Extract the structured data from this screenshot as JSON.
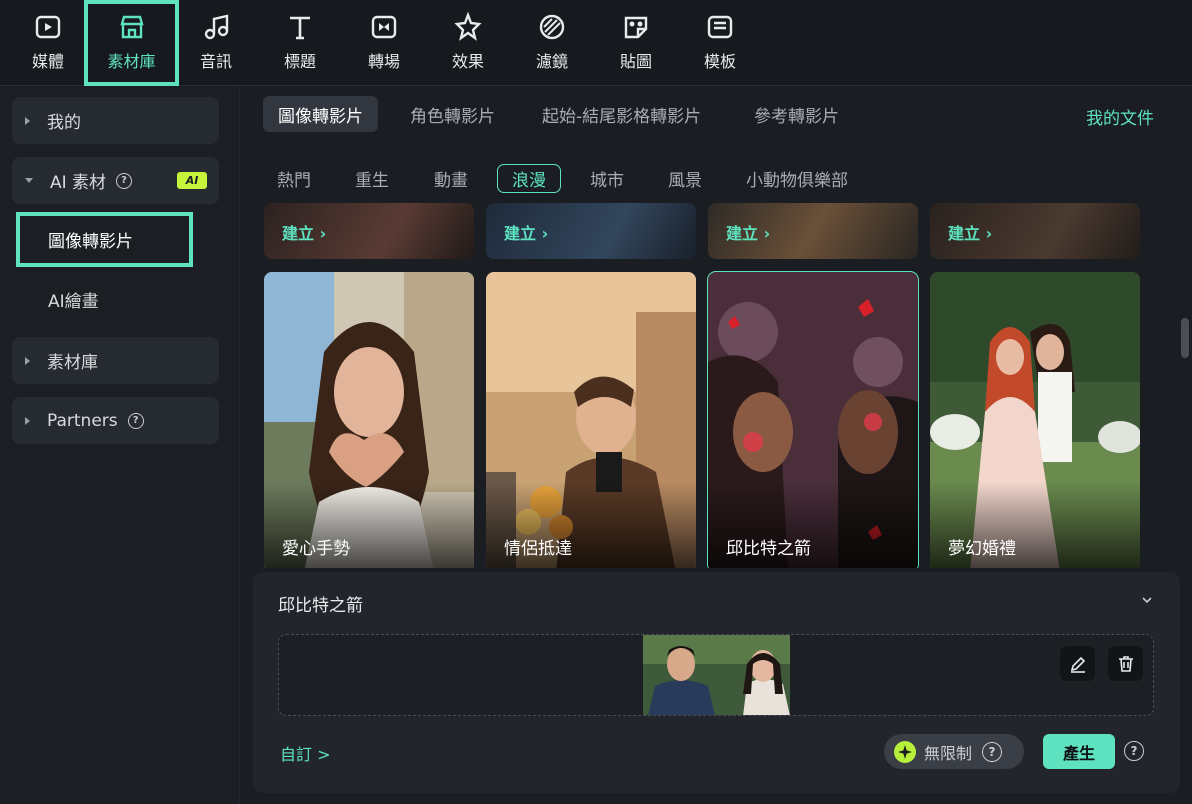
{
  "toolbar": {
    "items": [
      {
        "label": "媒體",
        "icon": "media-icon"
      },
      {
        "label": "素材庫",
        "icon": "store-icon",
        "active": true
      },
      {
        "label": "音訊",
        "icon": "music-note-icon"
      },
      {
        "label": "標題",
        "icon": "text-icon"
      },
      {
        "label": "轉場",
        "icon": "transition-icon"
      },
      {
        "label": "效果",
        "icon": "effects-star-icon"
      },
      {
        "label": "濾鏡",
        "icon": "filter-icon"
      },
      {
        "label": "貼圖",
        "icon": "sticker-icon"
      },
      {
        "label": "模板",
        "icon": "template-icon"
      }
    ]
  },
  "sidebar": {
    "mine": "我的",
    "ai_assets": "AI 素材",
    "ai_badge": "AI",
    "image_to_video": "圖像轉影片",
    "ai_painting": "AI繪畫",
    "library": "素材庫",
    "partners": "Partners"
  },
  "tabs": [
    "圖像轉影片",
    "角色轉影片",
    "起始-結尾影格轉影片",
    "參考轉影片"
  ],
  "my_docs": "我的文件",
  "chips": [
    "熱門",
    "重生",
    "動畫",
    "浪漫",
    "城市",
    "風景",
    "小動物俱樂部"
  ],
  "active_chip": "浪漫",
  "create_label": "建立 ›",
  "cards": [
    {
      "title": "愛心手勢"
    },
    {
      "title": "情侶抵達"
    },
    {
      "title": "邱比特之箭",
      "selected": true
    },
    {
      "title": "夢幻婚禮"
    }
  ],
  "panel": {
    "title": "邱比特之箭",
    "custom_link": "自訂 >",
    "credit_label": "無限制",
    "generate": "產生",
    "help": "?"
  },
  "colors": {
    "accent": "#5fe2c0",
    "ai_badge": "#c6f33b",
    "background": "#1a1d22"
  }
}
